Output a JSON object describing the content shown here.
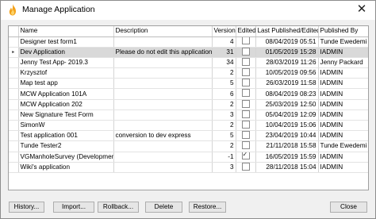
{
  "window": {
    "title": "Manage Application",
    "app_icon": "flame-icon",
    "close_glyph": "✕"
  },
  "grid": {
    "columns": [
      "Name",
      "Description",
      "Version",
      "Edited",
      "Last Published/Edited",
      "Published By"
    ],
    "current_row_marker": "▸",
    "rows": [
      {
        "name": "Designer test form1",
        "description": "",
        "version": "4",
        "edited": false,
        "last": "08/04/2019 05:51",
        "by": "Tunde Ewedemi"
      },
      {
        "name": "Dev Application",
        "description": "Please do not edit this application!!",
        "version": "31",
        "edited": false,
        "last": "01/05/2019 15:28",
        "by": "IADMIN",
        "selected": true
      },
      {
        "name": "Jenny Test App- 2019.3",
        "description": "",
        "version": "34",
        "edited": false,
        "last": "28/03/2019 11:26",
        "by": "Jenny Packard"
      },
      {
        "name": "Krzysztof",
        "description": "",
        "version": "2",
        "edited": false,
        "last": "10/05/2019 09:56",
        "by": "IADMIN"
      },
      {
        "name": "Map test app",
        "description": "",
        "version": "5",
        "edited": false,
        "last": "26/03/2019 11:58",
        "by": "IADMIN"
      },
      {
        "name": "MCW Application 101A",
        "description": "",
        "version": "6",
        "edited": false,
        "last": "08/04/2019 08:23",
        "by": "IADMIN"
      },
      {
        "name": "MCW Application 202",
        "description": "",
        "version": "2",
        "edited": false,
        "last": "25/03/2019 12:50",
        "by": "IADMIN"
      },
      {
        "name": "New Signature Test Form",
        "description": "",
        "version": "3",
        "edited": false,
        "last": "05/04/2019 12:09",
        "by": "IADMIN"
      },
      {
        "name": "SimonW",
        "description": "",
        "version": "2",
        "edited": false,
        "last": "10/04/2019 15:06",
        "by": "IADMIN"
      },
      {
        "name": "Test application 001",
        "description": "conversion to dev express",
        "version": "5",
        "edited": false,
        "last": "23/04/2019 10:44",
        "by": "IADMIN"
      },
      {
        "name": "Tunde Tester2",
        "description": "",
        "version": "2",
        "edited": false,
        "last": "21/11/2018 15:58",
        "by": "Tunde Ewedemi"
      },
      {
        "name": "VGManholeSurvey (Development)",
        "description": "",
        "version": "-1",
        "edited": true,
        "last": "16/05/2019 15:59",
        "by": "IADMIN"
      },
      {
        "name": "Wiki's application",
        "description": "",
        "version": "3",
        "edited": false,
        "last": "28/11/2018 15:04",
        "by": "IADMIN"
      }
    ]
  },
  "buttons": {
    "history": "History...",
    "import": "Import...",
    "rollback": "Rollback...",
    "delete": "Delete",
    "restore": "Restore...",
    "close": "Close"
  }
}
